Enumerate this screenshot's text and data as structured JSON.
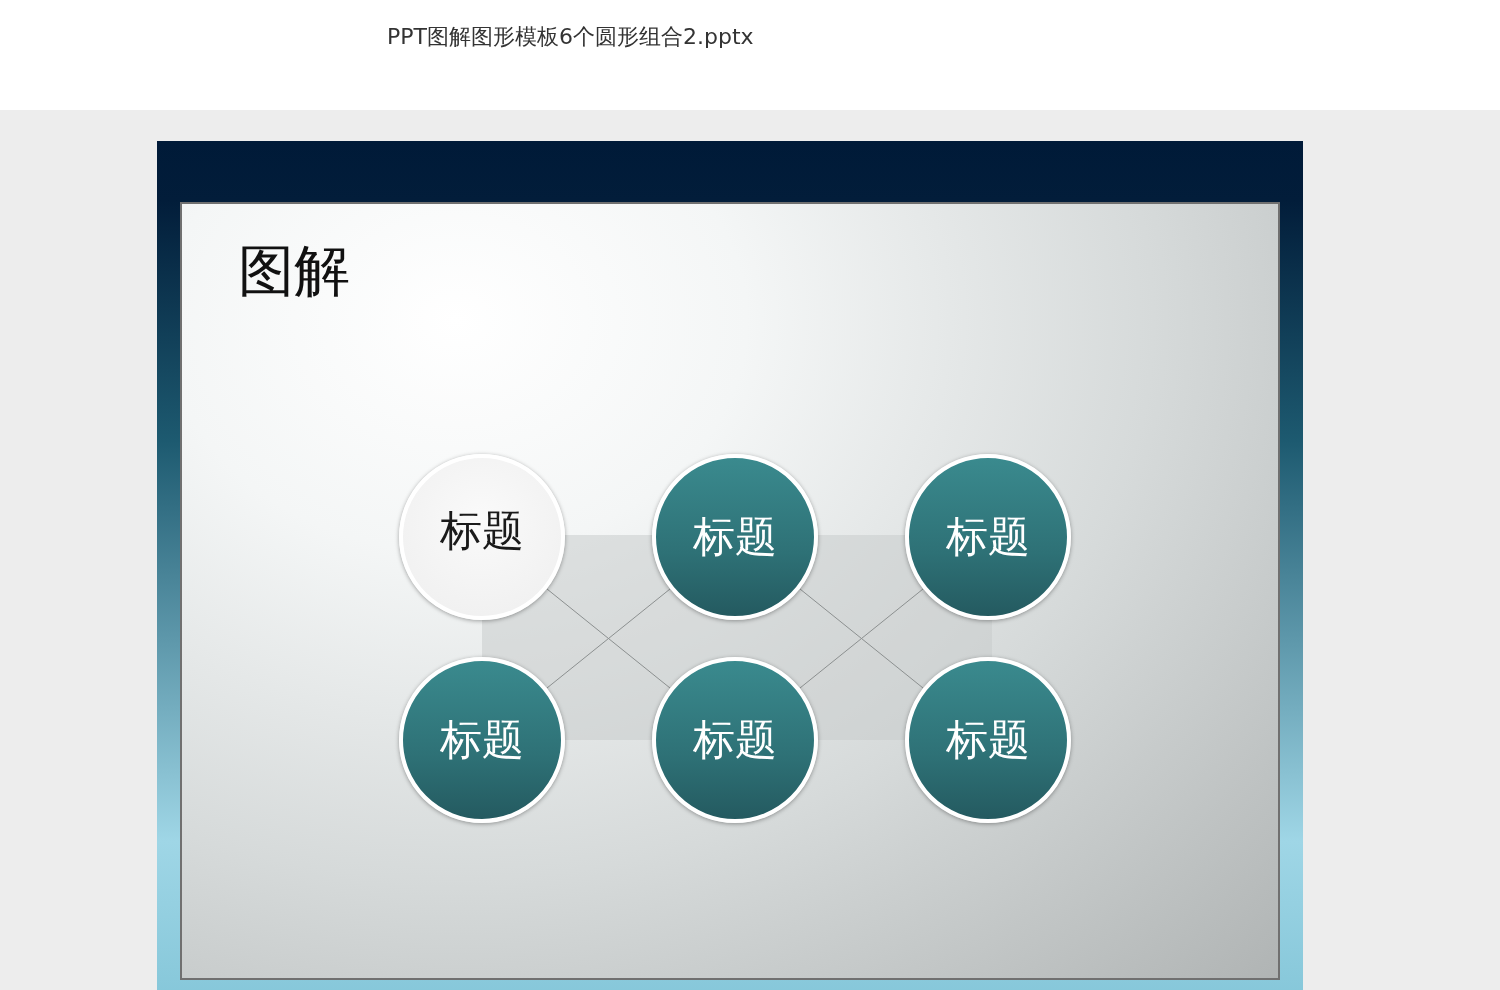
{
  "document": {
    "filename": "PPT图解图形模板6个圆形组合2.pptx"
  },
  "slide": {
    "title": "图解",
    "circles": [
      {
        "label": "标题",
        "kind": "light"
      },
      {
        "label": "标题",
        "kind": "teal"
      },
      {
        "label": "标题",
        "kind": "teal"
      },
      {
        "label": "标题",
        "kind": "teal"
      },
      {
        "label": "标题",
        "kind": "teal"
      },
      {
        "label": "标题",
        "kind": "teal"
      }
    ]
  }
}
